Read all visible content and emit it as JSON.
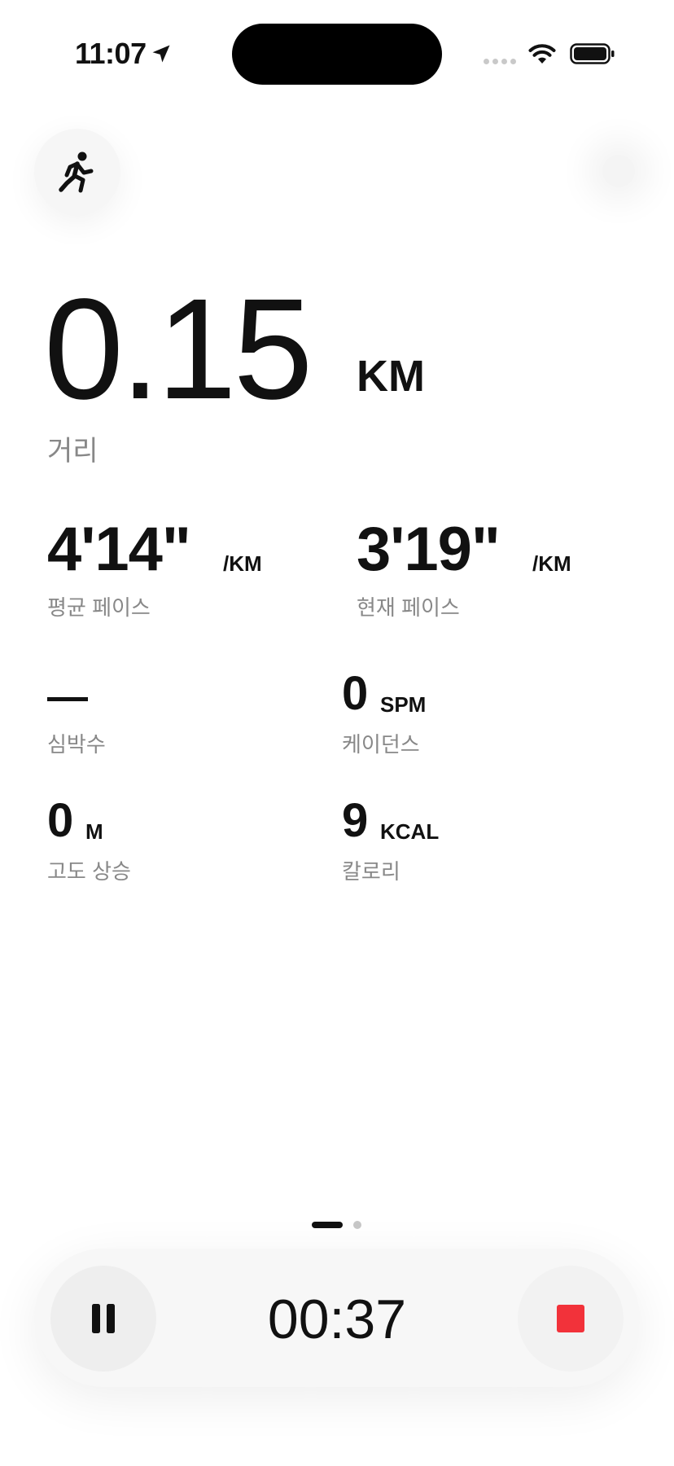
{
  "status_bar": {
    "time": "11:07"
  },
  "icons": {
    "location": "location-arrow-icon",
    "wifi": "wifi-icon",
    "battery": "battery-icon",
    "activity": "running-figure-icon",
    "pause": "pause-icon",
    "stop": "stop-square-icon"
  },
  "distance": {
    "value": "0.15",
    "unit": "KM",
    "label": "거리"
  },
  "pace": {
    "average": {
      "value": "4'14\"",
      "unit": "/KM",
      "label": "평균 페이스"
    },
    "current": {
      "value": "3'19\"",
      "unit": "/KM",
      "label": "현재 페이스"
    }
  },
  "stats": {
    "heart_rate": {
      "label": "심박수"
    },
    "cadence": {
      "value": "0",
      "unit": "SPM",
      "label": "케이던스"
    },
    "elevation": {
      "value": "0",
      "unit": "M",
      "label": "고도 상승"
    },
    "calories": {
      "value": "9",
      "unit": "KCAL",
      "label": "칼로리"
    }
  },
  "controls": {
    "timer": "00:37"
  },
  "colors": {
    "stop_accent": "#f2323a",
    "text_primary": "#111111",
    "text_secondary": "#888888"
  }
}
